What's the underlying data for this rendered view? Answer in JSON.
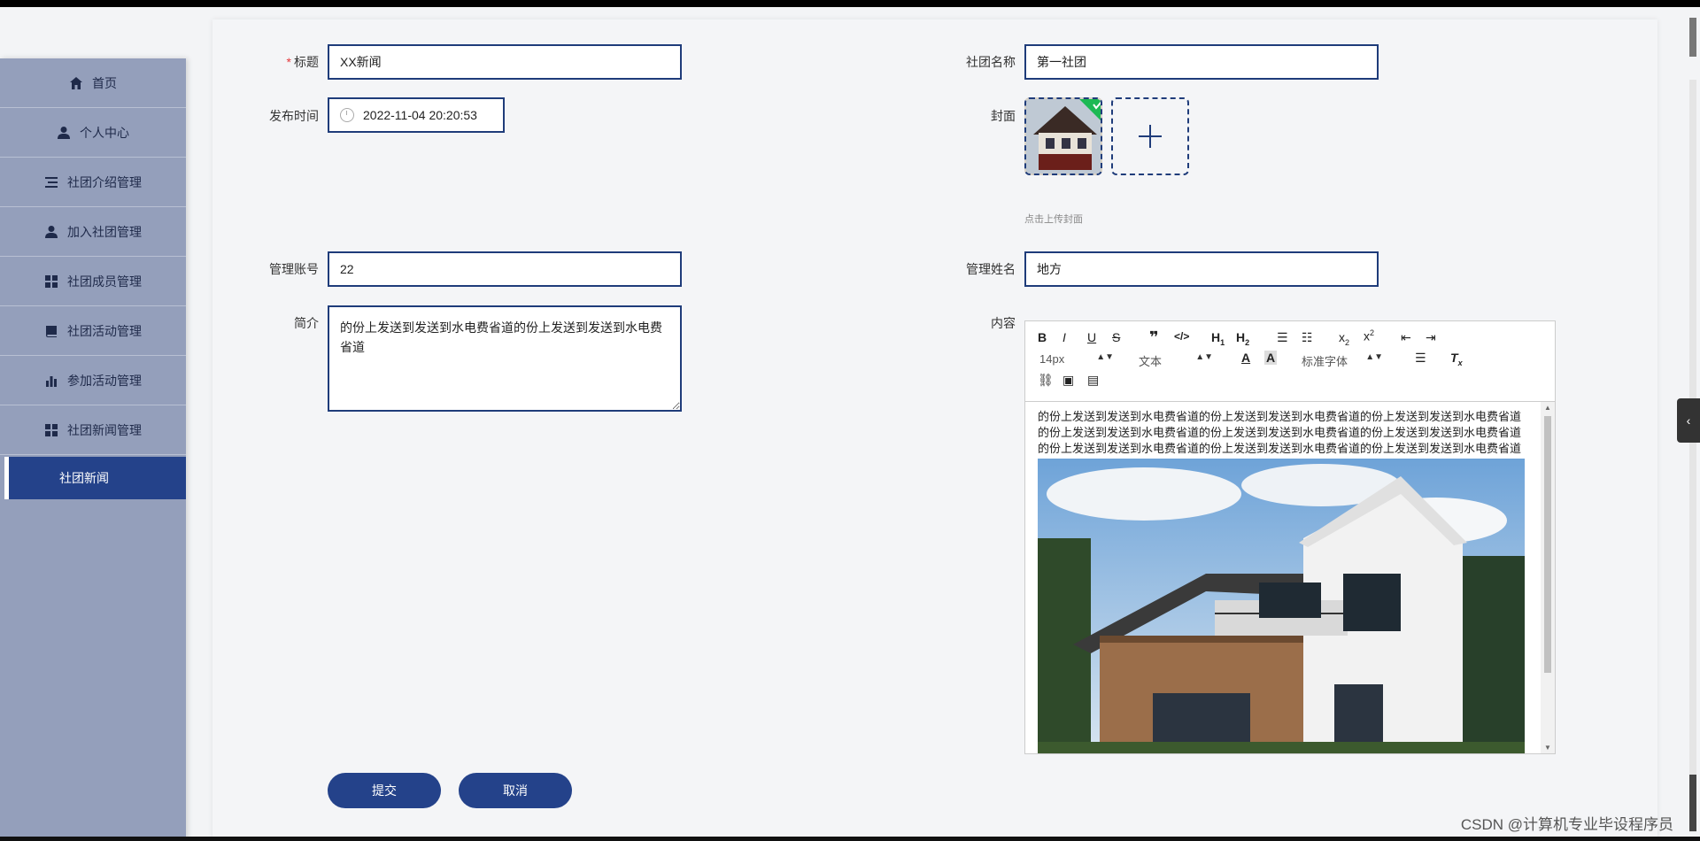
{
  "sidebar": {
    "items": [
      {
        "label": "首页",
        "icon": "home-icon"
      },
      {
        "label": "个人中心",
        "icon": "user-icon"
      },
      {
        "label": "社团介绍管理",
        "icon": "list-icon"
      },
      {
        "label": "加入社团管理",
        "icon": "user-icon"
      },
      {
        "label": "社团成员管理",
        "icon": "grid-icon"
      },
      {
        "label": "社团活动管理",
        "icon": "book-icon"
      },
      {
        "label": "参加活动管理",
        "icon": "bar-chart-icon"
      },
      {
        "label": "社团新闻管理",
        "icon": "grid-icon"
      }
    ],
    "active_sub": "社团新闻"
  },
  "form": {
    "title_label": "标题",
    "title_value": "XX新闻",
    "club_name_label": "社团名称",
    "club_name_value": "第一社团",
    "publish_time_label": "发布时间",
    "publish_time_value": "2022-11-04 20:20:53",
    "cover_label": "封面",
    "cover_hint": "点击上传封面",
    "admin_account_label": "管理账号",
    "admin_account_value": "22",
    "admin_name_label": "管理姓名",
    "admin_name_value": "地方",
    "intro_label": "简介",
    "intro_value": "的份上发送到发送到水电费省道的份上发送到发送到水电费省道",
    "content_label": "内容",
    "content_text": "的份上发送到发送到水电费省道的份上发送到发送到水电费省道的份上发送到发送到水电费省道的份上发送到发送到水电费省道的份上发送到发送到水电费省道的份上发送到发送到水电费省道的份上发送到发送到水电费省道的份上发送到发送到水电费省道的份上发送到发送到水电费省道"
  },
  "editor": {
    "font_size": "14px",
    "block_format": "文本",
    "font_family": "标准字体"
  },
  "buttons": {
    "submit": "提交",
    "cancel": "取消"
  },
  "watermark": "CSDN @计算机专业毕设程序员",
  "colors": {
    "accent": "#24428a",
    "sidebar": "#949fbb",
    "required": "#e4393c"
  }
}
